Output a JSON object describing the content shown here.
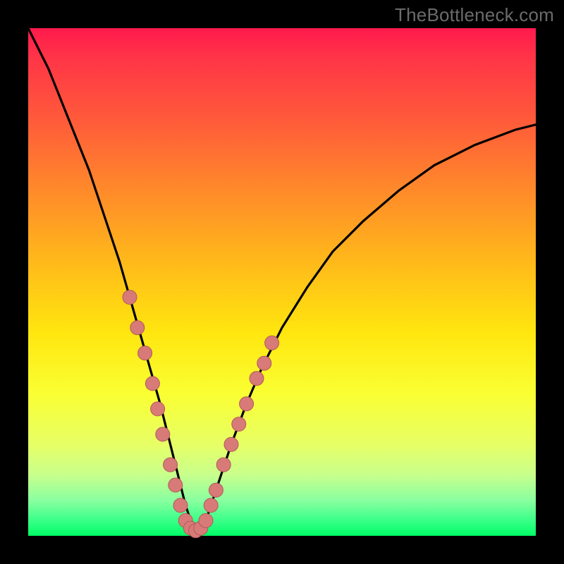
{
  "watermark": "TheBottleneck.com",
  "colors": {
    "frame": "#000000",
    "gradient_top": "#ff1a4d",
    "gradient_bottom": "#00ff66",
    "curve_stroke": "#000000",
    "dot_fill": "#d87a78",
    "dot_stroke": "#b05a58"
  },
  "chart_data": {
    "type": "line",
    "title": "",
    "xlabel": "",
    "ylabel": "",
    "xlim": [
      0,
      100
    ],
    "ylim": [
      0,
      100
    ],
    "note": "V-shaped bottleneck curve on rainbow gradient; y values are percent of plot height from bottom; dots highlight points in lower region.",
    "series": [
      {
        "name": "curve",
        "x": [
          0,
          4,
          8,
          12,
          15,
          18,
          20,
          22,
          24,
          26,
          27,
          28,
          29,
          30,
          31,
          32,
          33,
          34,
          35,
          36,
          38,
          40,
          43,
          46,
          50,
          55,
          60,
          66,
          73,
          80,
          88,
          96,
          100
        ],
        "values": [
          100,
          92,
          82,
          72,
          63,
          54,
          47,
          40,
          33,
          26,
          22,
          18,
          14,
          10,
          6,
          3,
          1,
          1,
          3,
          6,
          12,
          18,
          26,
          33,
          41,
          49,
          56,
          62,
          68,
          73,
          77,
          80,
          81
        ]
      }
    ],
    "dots": {
      "name": "highlight-dots",
      "points": [
        {
          "x": 20,
          "y": 47
        },
        {
          "x": 21.5,
          "y": 41
        },
        {
          "x": 23,
          "y": 36
        },
        {
          "x": 24.5,
          "y": 30
        },
        {
          "x": 25.5,
          "y": 25
        },
        {
          "x": 26.5,
          "y": 20
        },
        {
          "x": 28,
          "y": 14
        },
        {
          "x": 29,
          "y": 10
        },
        {
          "x": 30,
          "y": 6
        },
        {
          "x": 31,
          "y": 3
        },
        {
          "x": 32,
          "y": 1.5
        },
        {
          "x": 33,
          "y": 1
        },
        {
          "x": 34,
          "y": 1.5
        },
        {
          "x": 35,
          "y": 3
        },
        {
          "x": 36,
          "y": 6
        },
        {
          "x": 37,
          "y": 9
        },
        {
          "x": 38.5,
          "y": 14
        },
        {
          "x": 40,
          "y": 18
        },
        {
          "x": 41.5,
          "y": 22
        },
        {
          "x": 43,
          "y": 26
        },
        {
          "x": 45,
          "y": 31
        },
        {
          "x": 46.5,
          "y": 34
        },
        {
          "x": 48,
          "y": 38
        }
      ]
    }
  }
}
